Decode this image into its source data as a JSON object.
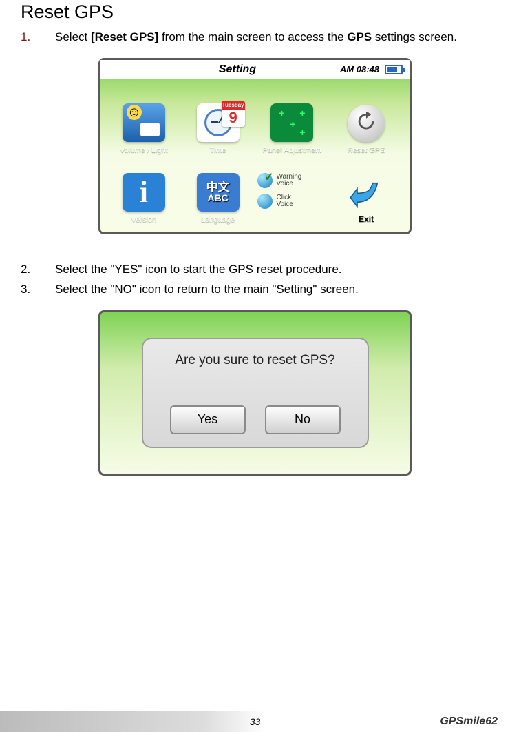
{
  "page": {
    "title": "Reset GPS",
    "steps": [
      {
        "num": "1.",
        "text": "Select [Reset GPS] from the main screen to access the GPS settings screen."
      },
      {
        "num": "2.",
        "text": "Select the \"YES\" icon to start the GPS reset procedure."
      },
      {
        "num": "3.",
        "text": "Select the \"NO\" icon to return to the main \"Setting\" screen."
      }
    ],
    "footer_page": "33",
    "footer_model": "GPSmile62"
  },
  "device1": {
    "title": "Setting",
    "clock": "AM 08:48",
    "calendar": {
      "weekday": "Tuesday",
      "day": "9"
    },
    "items": {
      "volume": "Volume / Light",
      "time": "Time",
      "panel": "Panel Adjustment",
      "reset": "Reset GPS",
      "version": "Version",
      "language": "Language",
      "lang_cn": "中文",
      "lang_abc": "ABC",
      "warning_voice": "Warning Voice",
      "click_voice": "Click Voice",
      "exit": "Exit"
    }
  },
  "device2": {
    "question": "Are you sure to reset GPS?",
    "yes": "Yes",
    "no": "No"
  }
}
